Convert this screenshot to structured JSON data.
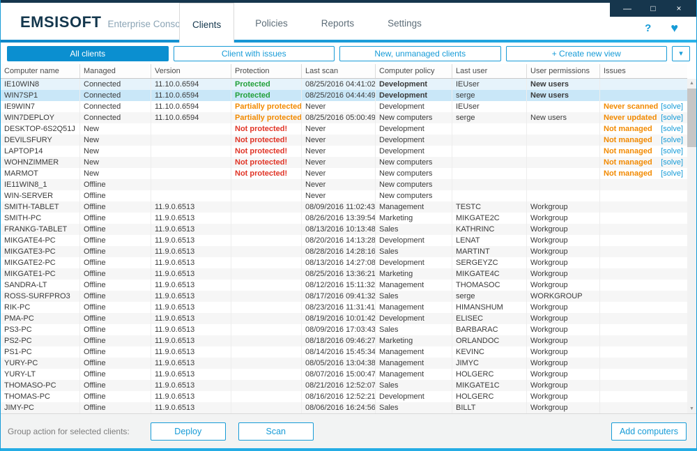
{
  "colors": {
    "accent": "#169bd7",
    "accent-dark": "#0b8fd0",
    "navy": "#16364d",
    "green": "#22a038",
    "orange": "#f28a00",
    "red": "#e03426"
  },
  "window": {
    "minimize": "—",
    "maximize": "□",
    "close": "×"
  },
  "header": {
    "logo": "EMSISOFT",
    "subtitle": "Enterprise Console",
    "help": "?",
    "heart": "♥",
    "tabs": [
      {
        "label": "Clients",
        "active": true
      },
      {
        "label": "Policies",
        "active": false
      },
      {
        "label": "Reports",
        "active": false
      },
      {
        "label": "Settings",
        "active": false
      }
    ]
  },
  "toolbar": {
    "views": [
      {
        "label": "All clients",
        "selected": true
      },
      {
        "label": "Client with issues",
        "selected": false
      },
      {
        "label": "New, unmanaged clients",
        "selected": false
      },
      {
        "label": "+ Create new view",
        "selected": false
      }
    ],
    "dropdown_icon": "▾"
  },
  "scrollbar": {
    "up": "▲",
    "down": "▼"
  },
  "table": {
    "columns": [
      "Computer name",
      "Managed",
      "Version",
      "Protection",
      "Last scan",
      "Computer policy",
      "Last user",
      "User permissions",
      "Issues"
    ],
    "solve_label": "[solve]",
    "rows": [
      {
        "name": "IE10WIN8",
        "managed": "Connected",
        "version": "11.10.0.6594",
        "protection": "Protected",
        "state": "ok",
        "last_scan": "08/25/2016 04:41:02",
        "policy": "Development",
        "policy_bold": true,
        "user": "IEUser",
        "permissions": "New users",
        "perm_bold": true,
        "issue": "",
        "solve": false,
        "selected": "light"
      },
      {
        "name": "WIN7SP1",
        "managed": "Connected",
        "version": "11.10.0.6594",
        "protection": "Protected",
        "state": "ok",
        "last_scan": "08/25/2016 04:44:49",
        "policy": "Development",
        "policy_bold": true,
        "user": "serge",
        "permissions": "New users",
        "perm_bold": true,
        "issue": "",
        "solve": false,
        "selected": "strong"
      },
      {
        "name": "IE9WIN7",
        "managed": "Connected",
        "version": "11.10.0.6594",
        "protection": "Partially protected",
        "state": "partial",
        "last_scan": "Never",
        "policy": "Development",
        "user": "IEUser",
        "permissions": "",
        "issue": "Never scanned",
        "solve": true
      },
      {
        "name": "WIN7DEPLOY",
        "managed": "Connected",
        "version": "11.10.0.6594",
        "protection": "Partially protected",
        "state": "partial",
        "last_scan": "08/25/2016 05:00:49",
        "policy": "New computers",
        "user": "serge",
        "permissions": "New users",
        "issue": "Never updated",
        "solve": true
      },
      {
        "name": "DESKTOP-6S2Q51J",
        "managed": "New",
        "version": "",
        "protection": "Not protected!",
        "state": "bad",
        "last_scan": "Never",
        "policy": "Development",
        "user": "",
        "permissions": "",
        "issue": "Not managed",
        "solve": true
      },
      {
        "name": "DEVILSFURY",
        "managed": "New",
        "version": "",
        "protection": "Not protected!",
        "state": "bad",
        "last_scan": "Never",
        "policy": "Development",
        "user": "",
        "permissions": "",
        "issue": "Not managed",
        "solve": true
      },
      {
        "name": "LAPTOP14",
        "managed": "New",
        "version": "",
        "protection": "Not protected!",
        "state": "bad",
        "last_scan": "Never",
        "policy": "Development",
        "user": "",
        "permissions": "",
        "issue": "Not managed",
        "solve": true
      },
      {
        "name": "WOHNZIMMER",
        "managed": "New",
        "version": "",
        "protection": "Not protected!",
        "state": "bad",
        "last_scan": "Never",
        "policy": "New computers",
        "user": "",
        "permissions": "",
        "issue": "Not managed",
        "solve": true
      },
      {
        "name": "MARMOT",
        "managed": "New",
        "version": "",
        "protection": "Not protected!",
        "state": "bad",
        "last_scan": "Never",
        "policy": "New computers",
        "user": "",
        "permissions": "",
        "issue": "Not managed",
        "solve": true
      },
      {
        "name": "IE11WIN8_1",
        "managed": "Offline",
        "version": "",
        "protection": "",
        "state": "",
        "last_scan": "Never",
        "policy": "New computers",
        "user": "",
        "permissions": "",
        "issue": "",
        "solve": false
      },
      {
        "name": "WIN-SERVER",
        "managed": "Offline",
        "version": "",
        "protection": "",
        "state": "",
        "last_scan": "Never",
        "policy": "New computers",
        "user": "",
        "permissions": "",
        "issue": "",
        "solve": false
      },
      {
        "name": "SMITH-TABLET",
        "managed": "Offline",
        "version": "11.9.0.6513",
        "protection": "",
        "state": "",
        "last_scan": "08/09/2016 11:02:43",
        "policy": "Management",
        "user": "TESTC",
        "permissions": "Workgroup",
        "issue": "",
        "solve": false
      },
      {
        "name": "SMITH-PC",
        "managed": "Offline",
        "version": "11.9.0.6513",
        "protection": "",
        "state": "",
        "last_scan": "08/26/2016 13:39:54",
        "policy": "Marketing",
        "user": "MIKGATE2C",
        "permissions": "Workgroup",
        "issue": "",
        "solve": false
      },
      {
        "name": "FRANKG-TABLET",
        "managed": "Offline",
        "version": "11.9.0.6513",
        "protection": "",
        "state": "",
        "last_scan": "08/13/2016 10:13:48",
        "policy": "Sales",
        "user": "KATHRINC",
        "permissions": "Workgroup",
        "issue": "",
        "solve": false
      },
      {
        "name": "MIKGATE4-PC",
        "managed": "Offline",
        "version": "11.9.0.6513",
        "protection": "",
        "state": "",
        "last_scan": "08/20/2016 14:13:28",
        "policy": "Development",
        "user": "LENAT",
        "permissions": "Workgroup",
        "issue": "",
        "solve": false
      },
      {
        "name": "MIKGATE3-PC",
        "managed": "Offline",
        "version": "11.9.0.6513",
        "protection": "",
        "state": "",
        "last_scan": "08/28/2016 14:28:16",
        "policy": "Sales",
        "user": "MARTINT",
        "permissions": "Workgroup",
        "issue": "",
        "solve": false
      },
      {
        "name": "MIKGATE2-PC",
        "managed": "Offline",
        "version": "11.9.0.6513",
        "protection": "",
        "state": "",
        "last_scan": "08/13/2016 14:27:08",
        "policy": "Development",
        "user": "SERGEYZC",
        "permissions": "Workgroup",
        "issue": "",
        "solve": false
      },
      {
        "name": "MIKGATE1-PC",
        "managed": "Offline",
        "version": "11.9.0.6513",
        "protection": "",
        "state": "",
        "last_scan": "08/25/2016 13:36:21",
        "policy": "Marketing",
        "user": "MIKGATE4C",
        "permissions": "Workgroup",
        "issue": "",
        "solve": false
      },
      {
        "name": "SANDRA-LT",
        "managed": "Offline",
        "version": "11.9.0.6513",
        "protection": "",
        "state": "",
        "last_scan": "08/12/2016 15:11:32",
        "policy": "Management",
        "user": "THOMASOC",
        "permissions": "Workgroup",
        "issue": "",
        "solve": false
      },
      {
        "name": "ROSS-SURFPRO3",
        "managed": "Offline",
        "version": "11.9.0.6513",
        "protection": "",
        "state": "",
        "last_scan": "08/17/2016 09:41:32",
        "policy": "Sales",
        "user": "serge",
        "permissions": "WORKGROUP",
        "issue": "",
        "solve": false
      },
      {
        "name": "RIK-PC",
        "managed": "Offline",
        "version": "11.9.0.6513",
        "protection": "",
        "state": "",
        "last_scan": "08/23/2016 11:31:41",
        "policy": "Management",
        "user": "HIMANSHUM",
        "permissions": "Workgroup",
        "issue": "",
        "solve": false
      },
      {
        "name": "PMA-PC",
        "managed": "Offline",
        "version": "11.9.0.6513",
        "protection": "",
        "state": "",
        "last_scan": "08/19/2016 10:01:42",
        "policy": "Development",
        "user": "ELISEC",
        "permissions": "Workgroup",
        "issue": "",
        "solve": false
      },
      {
        "name": "PS3-PC",
        "managed": "Offline",
        "version": "11.9.0.6513",
        "protection": "",
        "state": "",
        "last_scan": "08/09/2016 17:03:43",
        "policy": "Sales",
        "user": "BARBARAC",
        "permissions": "Workgroup",
        "issue": "",
        "solve": false
      },
      {
        "name": "PS2-PC",
        "managed": "Offline",
        "version": "11.9.0.6513",
        "protection": "",
        "state": "",
        "last_scan": "08/18/2016 09:46:27",
        "policy": "Marketing",
        "user": "ORLANDOC",
        "permissions": "Workgroup",
        "issue": "",
        "solve": false
      },
      {
        "name": "PS1-PC",
        "managed": "Offline",
        "version": "11.9.0.6513",
        "protection": "",
        "state": "",
        "last_scan": "08/14/2016 15:45:34",
        "policy": "Management",
        "user": "KEVINC",
        "permissions": "Workgroup",
        "issue": "",
        "solve": false
      },
      {
        "name": "YURY-PC",
        "managed": "Offline",
        "version": "11.9.0.6513",
        "protection": "",
        "state": "",
        "last_scan": "08/05/2016 13:04:38",
        "policy": "Management",
        "user": "JIMYC",
        "permissions": "Workgroup",
        "issue": "",
        "solve": false
      },
      {
        "name": "YURY-LT",
        "managed": "Offline",
        "version": "11.9.0.6513",
        "protection": "",
        "state": "",
        "last_scan": "08/07/2016 15:00:47",
        "policy": "Management",
        "user": "HOLGERC",
        "permissions": "Workgroup",
        "issue": "",
        "solve": false
      },
      {
        "name": "THOMASO-PC",
        "managed": "Offline",
        "version": "11.9.0.6513",
        "protection": "",
        "state": "",
        "last_scan": "08/21/2016 12:52:07",
        "policy": "Sales",
        "user": "MIKGATE1C",
        "permissions": "Workgroup",
        "issue": "",
        "solve": false
      },
      {
        "name": "THOMAS-PC",
        "managed": "Offline",
        "version": "11.9.0.6513",
        "protection": "",
        "state": "",
        "last_scan": "08/16/2016 12:52:21",
        "policy": "Development",
        "user": "HOLGERC",
        "permissions": "Workgroup",
        "issue": "",
        "solve": false
      },
      {
        "name": "JIMY-PC",
        "managed": "Offline",
        "version": "11.9.0.6513",
        "protection": "",
        "state": "",
        "last_scan": "08/06/2016 16:24:56",
        "policy": "Sales",
        "user": "BILLT",
        "permissions": "Workgroup",
        "issue": "",
        "solve": false
      }
    ]
  },
  "footer": {
    "label": "Group action for selected clients:",
    "deploy": "Deploy",
    "scan": "Scan",
    "add": "Add computers"
  }
}
